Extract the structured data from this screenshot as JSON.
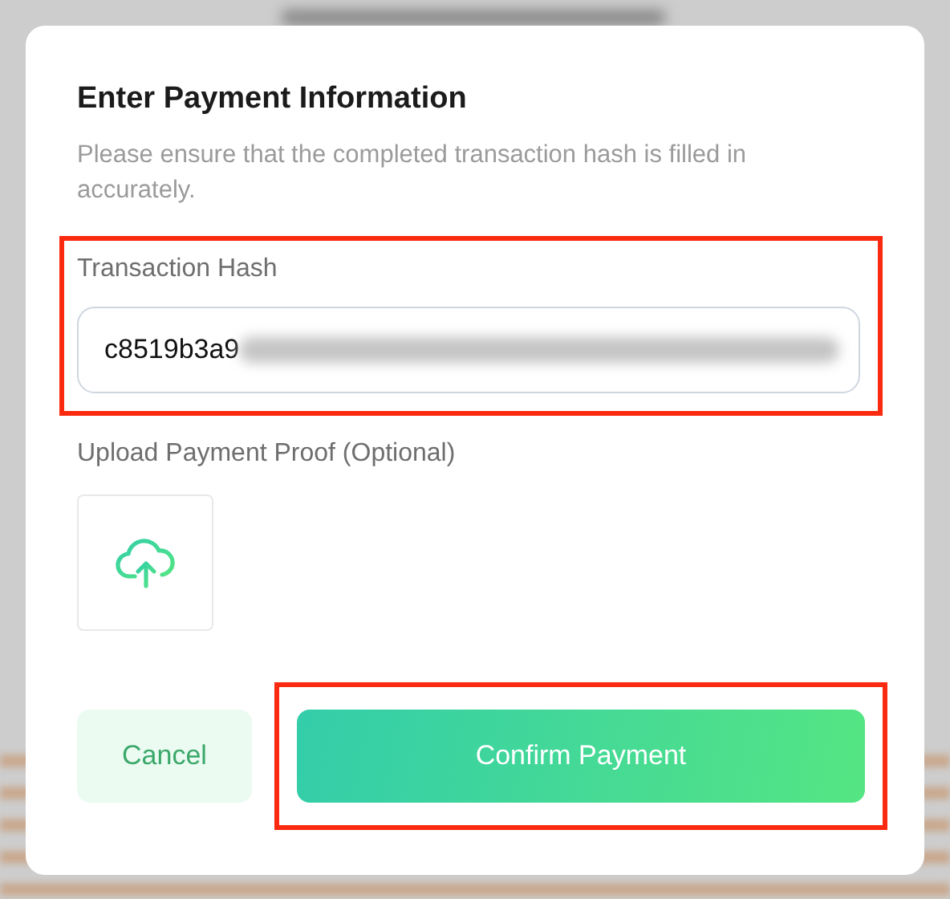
{
  "dialog": {
    "title": "Enter Payment Information",
    "subtitle": "Please ensure that the completed transaction hash is filled in accurately.",
    "hash_field": {
      "label": "Transaction Hash",
      "value": "c8519b3a9",
      "redacted": true,
      "highlighted": true
    },
    "upload": {
      "label": "Upload Payment Proof (Optional)"
    },
    "buttons": [
      {
        "label": "Cancel",
        "kind": "secondary",
        "highlighted": false
      },
      {
        "label": "Confirm Payment",
        "kind": "primary",
        "highlighted": true
      }
    ]
  }
}
